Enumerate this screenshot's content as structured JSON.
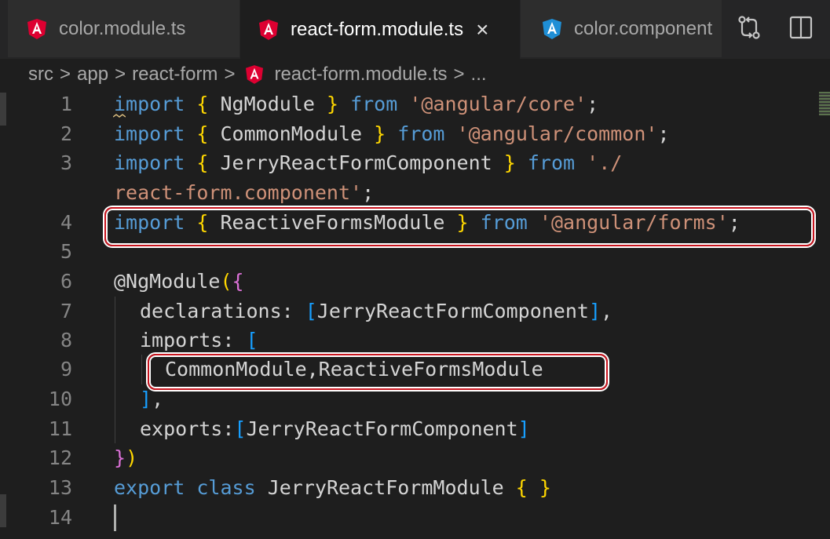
{
  "tabs": [
    {
      "label": "color.module.ts",
      "icon": "angular-icon"
    },
    {
      "label": "react-form.module.ts",
      "icon": "angular-icon",
      "close": "×"
    },
    {
      "label": "color.component",
      "icon": "angular-blue-icon"
    }
  ],
  "tab_actions": {
    "compare_icon": "git-compare-icon",
    "split_icon": "split-editor-icon"
  },
  "breadcrumb": {
    "items": [
      "src",
      "app",
      "react-form",
      "react-form.module.ts",
      "..."
    ],
    "separator": ">"
  },
  "gutter": [
    "1",
    "2",
    "3",
    "",
    "4",
    "5",
    "6",
    "7",
    "8",
    "9",
    "10",
    "11",
    "12",
    "13",
    "14"
  ],
  "code": {
    "l1": {
      "kw": "import",
      "b1": "{",
      "name": " NgModule ",
      "b2": "}",
      "from": "from",
      "str": "'@angular/core'",
      "end": ";"
    },
    "l2": {
      "kw": "import",
      "b1": "{",
      "name": " CommonModule ",
      "b2": "}",
      "from": "from",
      "str": "'@angular/common'",
      "end": ";"
    },
    "l3": {
      "kw": "import",
      "b1": "{",
      "name": " JerryReactFormComponent ",
      "b2": "}",
      "from": "from",
      "str": "'./"
    },
    "l3b": {
      "str": "react-form.component'",
      "end": ";"
    },
    "l4": {
      "kw": "import",
      "b1": "{",
      "name": " ReactiveFormsModule ",
      "b2": "}",
      "from": "from",
      "str": "'@angular/forms'",
      "end": ";"
    },
    "l6": {
      "dec": "@NgModule",
      "p": "(",
      "b": "{"
    },
    "l7": {
      "prop": "declarations: ",
      "b1": "[",
      "name": "JerryReactFormComponent",
      "b2": "]",
      "end": ","
    },
    "l8": {
      "prop": "imports: ",
      "b1": "["
    },
    "l9": {
      "name": "CommonModule,ReactiveFormsModule"
    },
    "l10": {
      "b": "]",
      "end": ","
    },
    "l11": {
      "prop": "exports:",
      "b1": "[",
      "name": "JerryReactFormComponent",
      "b2": "]"
    },
    "l12": {
      "b": "}",
      "p": ")"
    },
    "l13": {
      "kw": "export",
      "kw2": "class",
      "name": " JerryReactFormModule ",
      "b1": "{",
      "b2": "}"
    }
  },
  "colors": {
    "keyword": "#569cd6",
    "string": "#ce9178",
    "bracket_gold": "#ffd700",
    "bracket_purple": "#da70d6",
    "bracket_blue": "#179fff",
    "highlight_border": "#c8141e"
  }
}
